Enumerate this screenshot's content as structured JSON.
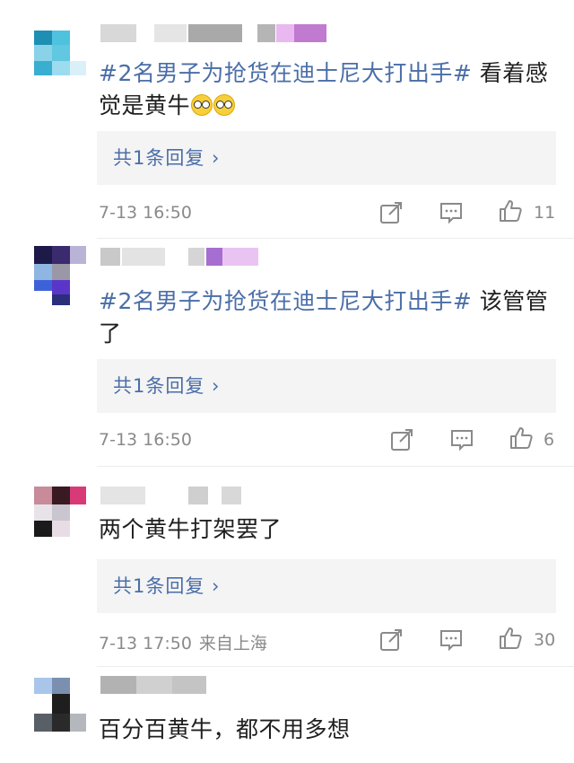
{
  "comments": [
    {
      "topic": "#2名男子为抢货在迪士尼大打出手#",
      "text": " 看着感觉是黄牛",
      "emoji": [
        "bespectacled-face",
        "bespectacled-face"
      ],
      "reply": "共1条回复 ›",
      "time": "7-13 16:50",
      "location": "",
      "likes": "11"
    },
    {
      "topic": "#2名男子为抢货在迪士尼大打出手#",
      "text": " 该管管了",
      "reply": "共1条回复 ›",
      "time": "7-13 16:50",
      "location": "",
      "likes": "6"
    },
    {
      "topic": "",
      "text": "两个黄牛打架罢了",
      "reply": "共1条回复 ›",
      "time": "7-13 17:50",
      "location": "来自上海",
      "likes": "30"
    },
    {
      "topic": "",
      "text": "百分百黄牛，都不用多想"
    }
  ],
  "icons": {
    "share": "share-icon",
    "comment": "comment-icon",
    "like": "thumbs-up-icon"
  },
  "colors": {
    "topic": "#4a6ea8",
    "meta": "#8a8a8a",
    "reply_bg": "#f4f4f4"
  }
}
